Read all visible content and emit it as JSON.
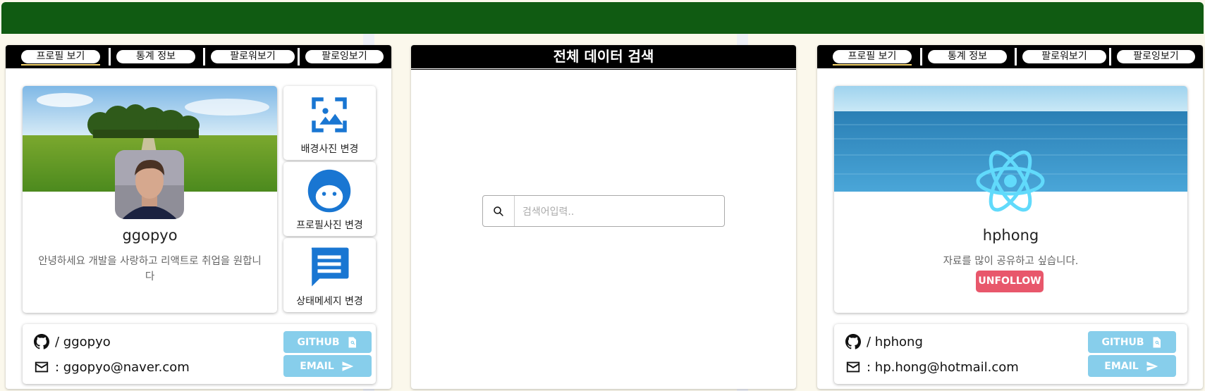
{
  "colors": {
    "header": "#105b12",
    "accent": "#1976d2",
    "link_button": "#87ceeb",
    "unfollow": "#e8576b"
  },
  "left_panel": {
    "tabs": [
      "프로필 보기",
      "통계 정보",
      "팔로워보기",
      "팔로잉보기"
    ],
    "username": "ggopyo",
    "status_message": "안녕하세요 개발을 사랑하고 리액트로 취업을 원합니다",
    "actions": {
      "bg": "배경사진 변경",
      "profile": "프로필사진 변경",
      "status": "상태메세지 변경"
    },
    "github_handle": "/ ggopyo",
    "email": ": ggopyo@naver.com",
    "github_button": "GITHUB",
    "email_button": "EMAIL"
  },
  "center_panel": {
    "title": "전체 데이터 검색",
    "search_placeholder": "검색어입력.."
  },
  "right_panel": {
    "tabs": [
      "프로필 보기",
      "통계 정보",
      "팔로워보기",
      "팔로잉보기"
    ],
    "username": "hphong",
    "status_message": "자료를 많이 공유하고 싶습니다.",
    "unfollow_button": "UNFOLLOW",
    "github_handle": "/ hphong",
    "email": ": hp.hong@hotmail.com",
    "github_button": "GITHUB",
    "email_button": "EMAIL"
  }
}
